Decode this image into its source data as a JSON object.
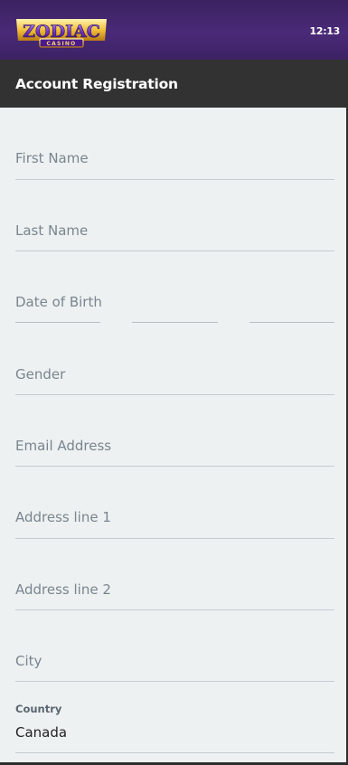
{
  "header": {
    "logo_text": "ZODIAC",
    "logo_subtext": "CASINO",
    "time": "12:13"
  },
  "titlebar": {
    "title": "Account Registration"
  },
  "form": {
    "first_name": {
      "placeholder": "First Name"
    },
    "last_name": {
      "placeholder": "Last Name"
    },
    "date_of_birth": {
      "placeholder": "Date of Birth"
    },
    "gender": {
      "placeholder": "Gender"
    },
    "email": {
      "placeholder": "Email Address"
    },
    "address_line_1": {
      "placeholder": "Address line 1"
    },
    "address_line_2": {
      "placeholder": "Address line 2"
    },
    "city": {
      "placeholder": "City"
    },
    "country": {
      "label": "Country",
      "value": "Canada"
    }
  },
  "colors": {
    "header_purple": "#4a2a78",
    "titlebar_dark": "#323232",
    "form_background": "#edf1f2",
    "placeholder_gray": "#7a858e"
  }
}
